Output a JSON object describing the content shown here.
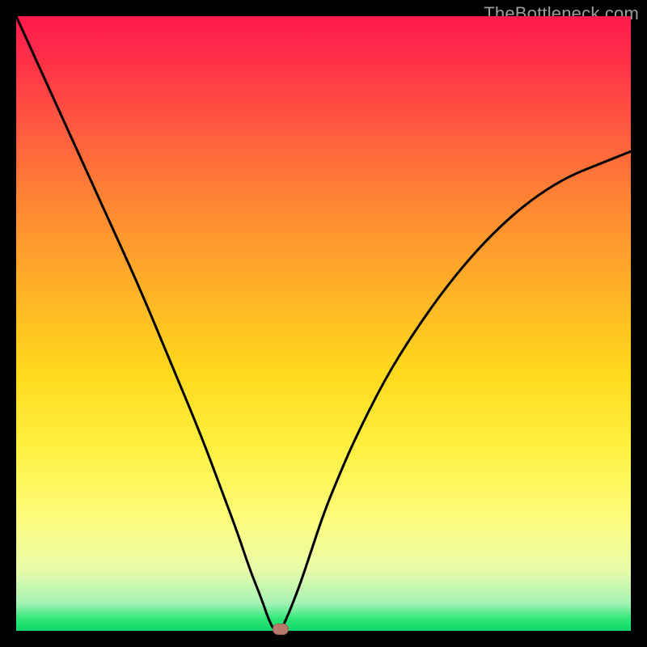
{
  "watermark": {
    "text": "TheBottleneck.com"
  },
  "chart_data": {
    "type": "line",
    "title": "",
    "xlabel": "",
    "ylabel": "",
    "xlim": [
      0,
      100
    ],
    "ylim": [
      0,
      100
    ],
    "grid": false,
    "legend": false,
    "series": [
      {
        "name": "bottleneck-curve",
        "x": [
          0,
          5,
          10,
          15,
          20,
          25,
          30,
          33,
          36,
          38,
          40,
          41,
          42,
          43,
          44,
          46,
          48,
          50,
          52,
          55,
          60,
          65,
          70,
          75,
          80,
          85,
          90,
          95,
          100
        ],
        "values": [
          100,
          89,
          78,
          67,
          56,
          44,
          32,
          24,
          16,
          10,
          5,
          2,
          0,
          0,
          2,
          7,
          13,
          19,
          24,
          31,
          41,
          49,
          56,
          62,
          67,
          71,
          74,
          76,
          78
        ]
      }
    ],
    "marker": {
      "x": 43,
      "y": 0,
      "color": "#b97a6e"
    },
    "background_gradient": {
      "stops": [
        {
          "pos": 0,
          "color": "#ff1a4d"
        },
        {
          "pos": 0.5,
          "color": "#ffd91c"
        },
        {
          "pos": 0.85,
          "color": "#fdfd7d"
        },
        {
          "pos": 1.0,
          "color": "#0dd968"
        }
      ]
    }
  }
}
